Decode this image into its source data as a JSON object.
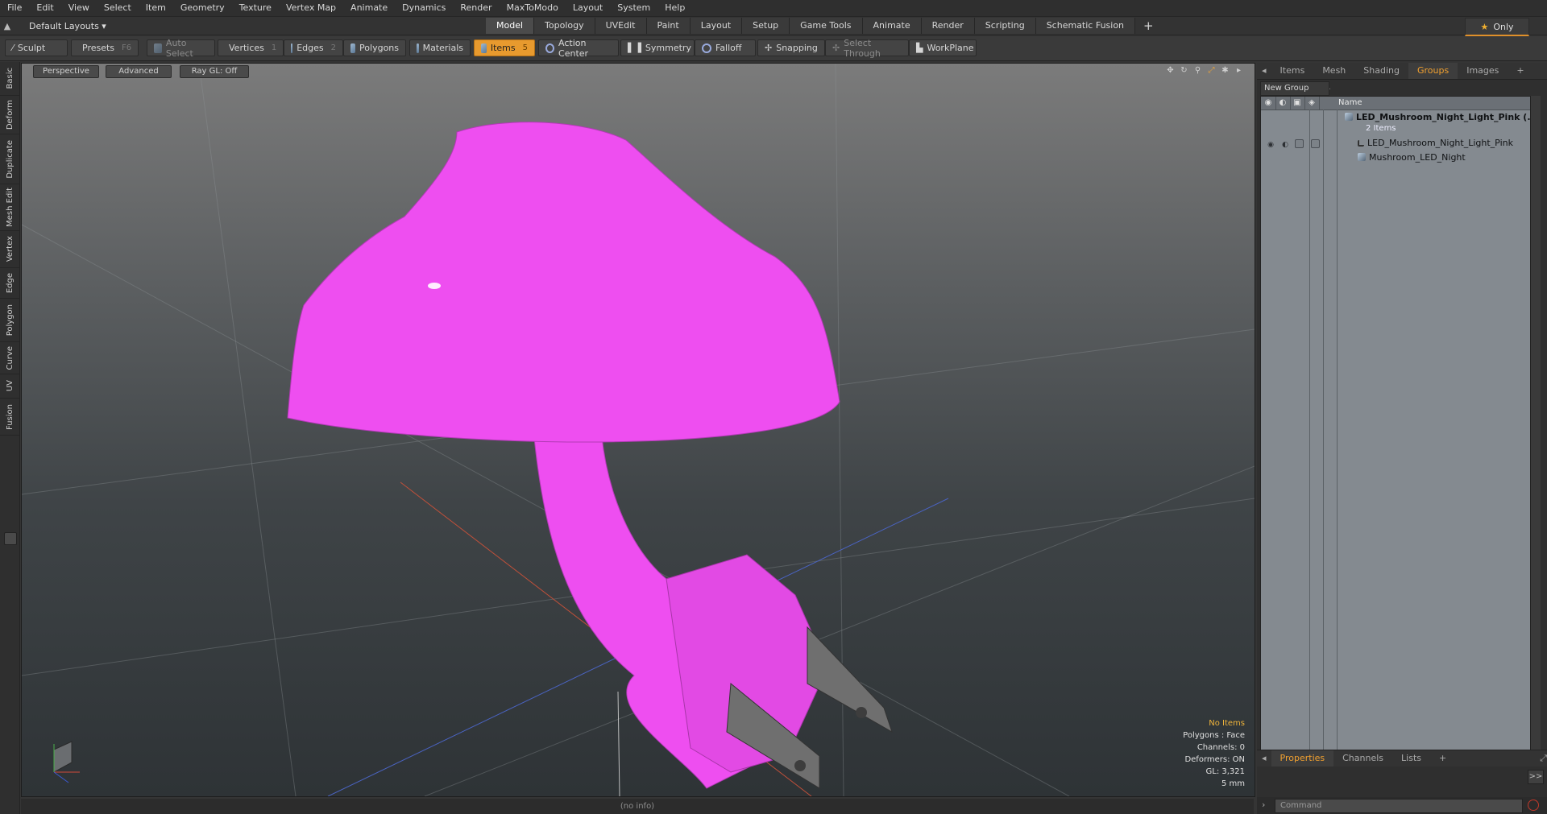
{
  "menu": [
    "File",
    "Edit",
    "View",
    "Select",
    "Item",
    "Geometry",
    "Texture",
    "Vertex Map",
    "Animate",
    "Dynamics",
    "Render",
    "MaxToModo",
    "Layout",
    "System",
    "Help"
  ],
  "layout_select": "Default Layouts ▾",
  "mode_tabs": [
    "Model",
    "Topology",
    "UVEdit",
    "Paint",
    "Layout",
    "Setup",
    "Game Tools",
    "Animate",
    "Render",
    "Scripting",
    "Schematic Fusion"
  ],
  "only_label": "Only",
  "toolbar": {
    "sculpt": "Sculpt",
    "presets": "Presets",
    "presets_key": "F6",
    "auto_select": "Auto Select",
    "vertices": "Vertices",
    "vertices_key": "1",
    "edges": "Edges",
    "edges_key": "2",
    "polygons": "Polygons",
    "materials": "Materials",
    "items": "Items",
    "items_key": "5",
    "action_center": "Action Center",
    "symmetry": "Symmetry",
    "falloff": "Falloff",
    "snapping": "Snapping",
    "select_through": "Select Through",
    "workplane": "WorkPlane"
  },
  "left_tabs": [
    "Basic",
    "Deform",
    "Duplicate",
    "Mesh Edit",
    "Vertex",
    "Edge",
    "Polygon",
    "Curve",
    "UV",
    "Fusion"
  ],
  "viewport": {
    "perspective": "Perspective",
    "advanced": "Advanced",
    "raygl": "Ray GL: Off",
    "info": {
      "no_items": "No Items",
      "polygons": "Polygons : Face",
      "channels": "Channels: 0",
      "deformers": "Deformers: ON",
      "gl": "GL: 3,321",
      "scale": "5 mm"
    }
  },
  "status": "(no info)",
  "right_panel": {
    "tabs": [
      "Items",
      "Mesh ...",
      "Shading",
      "Groups",
      "Images"
    ],
    "active_tab": "Groups",
    "new_group": "New Group",
    "name_col": "Name",
    "rows": [
      {
        "name": "LED_Mushroom_Night_Light_Pink (...",
        "kind": "group"
      },
      {
        "name": "2 Items",
        "kind": "count"
      },
      {
        "name": "LED_Mushroom_Night_Light_Pink",
        "kind": "locator"
      },
      {
        "name": "Mushroom_LED_Night",
        "kind": "mesh"
      }
    ]
  },
  "bottom_panel": {
    "tabs": [
      "Properties",
      "Channels",
      "Lists"
    ],
    "active_tab": "Properties",
    "command_placeholder": "Command",
    "expand": ">>"
  },
  "colors": {
    "accent": "#e89a2e",
    "mesh_pink": "#ee4ef0",
    "list_bg": "#848a90"
  }
}
